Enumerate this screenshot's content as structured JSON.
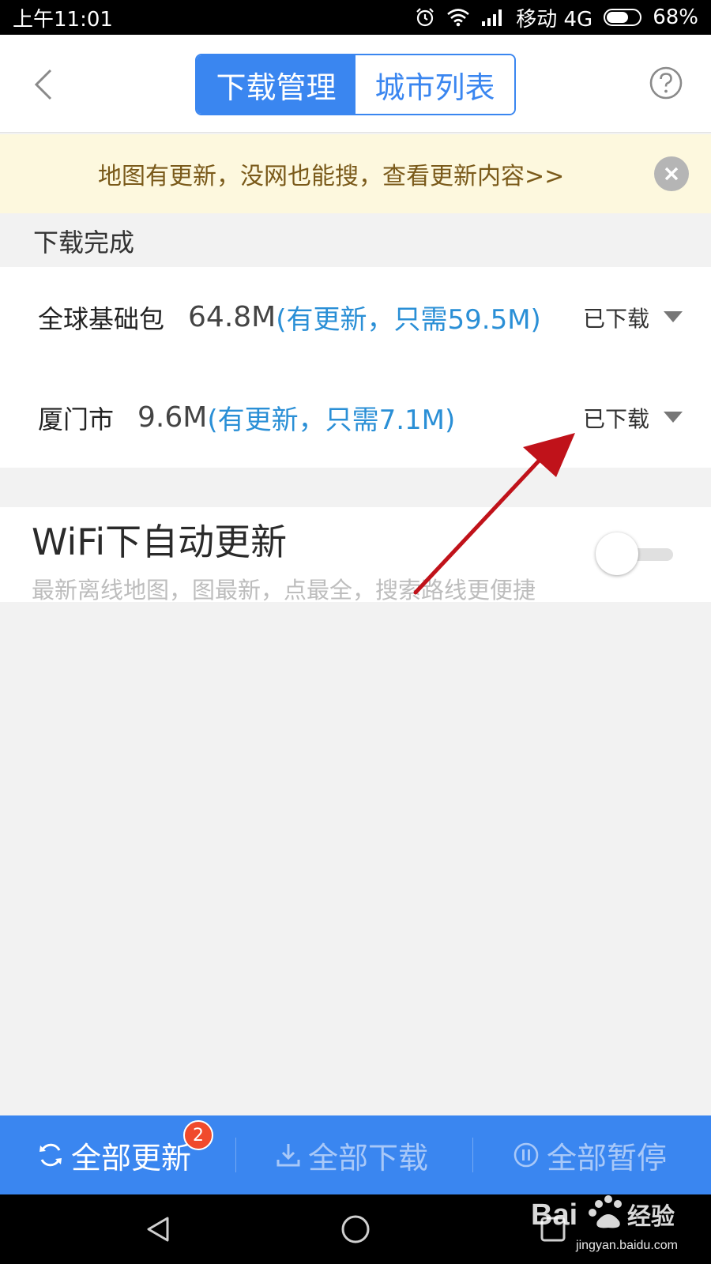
{
  "status_bar": {
    "time": "上午11:01",
    "carrier": "移动 4G",
    "battery": "68%",
    "battery_level": 0.68,
    "icons": [
      "alarm-icon",
      "wifi-icon",
      "signal-icon",
      "battery-icon"
    ]
  },
  "header": {
    "back_icon": "chevron-left-icon",
    "tabs": [
      {
        "label": "下载管理",
        "active": true
      },
      {
        "label": "城市列表",
        "active": false
      }
    ],
    "help_icon": "question-circle-icon"
  },
  "banner": {
    "text": "地图有更新，没网也能搜，查看更新内容>>",
    "close_icon": "close-circle-icon"
  },
  "section": {
    "title": "下载完成"
  },
  "downloads": [
    {
      "name": "全球基础包",
      "size": "64.8M",
      "update_text": "(有更新，只需59.5M)",
      "status": "已下载"
    },
    {
      "name": "厦门市",
      "size": "9.6M",
      "update_text": "(有更新，只需7.1M)",
      "status": "已下载"
    }
  ],
  "wifi_setting": {
    "title": "WiFi下自动更新",
    "subtitle": "最新离线地图，图最新，点最全，搜索路线更便捷",
    "enabled": false
  },
  "bottom_bar": {
    "update_all": "全部更新",
    "update_badge": "2",
    "download_all": "全部下载",
    "pause_all": "全部暂停"
  },
  "colors": {
    "accent": "#3a86f0",
    "link": "#2a8fd6",
    "banner_bg": "#fdf8de",
    "banner_text": "#7a5a1a",
    "badge": "#f04a2c",
    "annotation_arrow": "#c0121a"
  },
  "watermark": {
    "brand": "Baidu经验",
    "url": "jingyan.baidu.com"
  }
}
